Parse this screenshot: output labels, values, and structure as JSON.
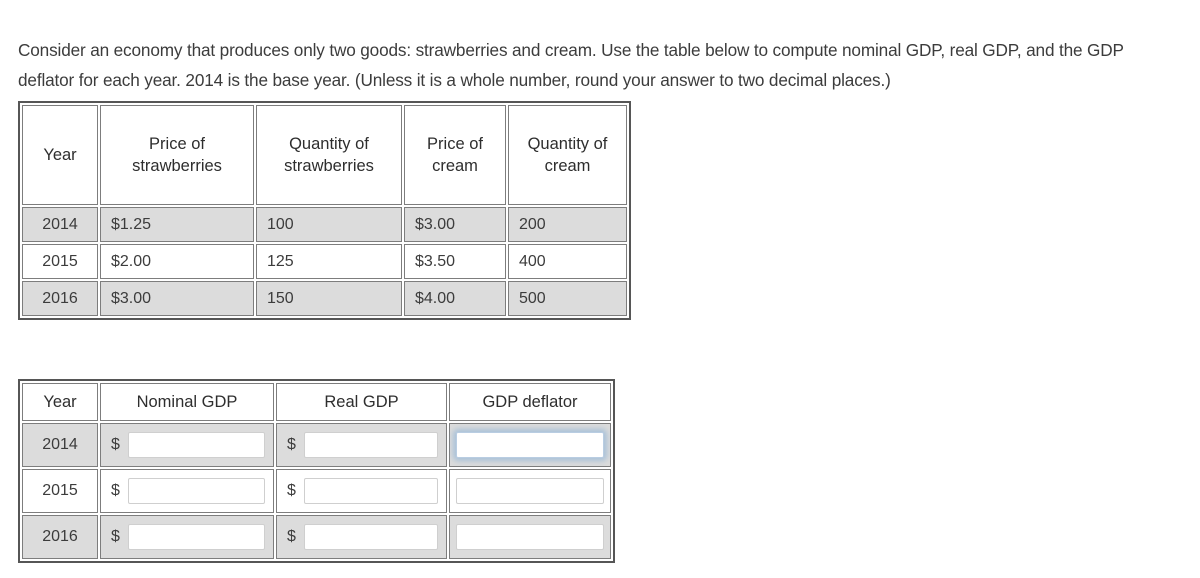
{
  "prompt": {
    "text": "Consider an economy that produces only two goods: strawberries and cream. Use the table below to compute nominal GDP, real GDP, and the GDP deflator for each year. 2014 is the base year. (Unless it is a whole number, round your answer to two decimal places.)"
  },
  "goods_table": {
    "headers": [
      "Year",
      "Price of strawberries",
      "Quantity of strawberries",
      "Price of cream",
      "Quantity of cream"
    ],
    "rows": [
      {
        "year": "2014",
        "price_strawberries": "$1.25",
        "qty_strawberries": "100",
        "price_cream": "$3.00",
        "qty_cream": "200",
        "shaded": true
      },
      {
        "year": "2015",
        "price_strawberries": "$2.00",
        "qty_strawberries": "125",
        "price_cream": "$3.50",
        "qty_cream": "400",
        "shaded": false
      },
      {
        "year": "2016",
        "price_strawberries": "$3.00",
        "qty_strawberries": "150",
        "price_cream": "$4.00",
        "qty_cream": "500",
        "shaded": true
      }
    ]
  },
  "answers_table": {
    "headers": [
      "Year",
      "Nominal GDP",
      "Real GDP",
      "GDP deflator"
    ],
    "currency_prefix": "$",
    "rows": [
      {
        "year": "2014",
        "nominal_gdp": "",
        "real_gdp": "",
        "gdp_deflator": "",
        "shaded": true,
        "focused_field": "gdp_deflator"
      },
      {
        "year": "2015",
        "nominal_gdp": "",
        "real_gdp": "",
        "gdp_deflator": "",
        "shaded": false,
        "focused_field": ""
      },
      {
        "year": "2016",
        "nominal_gdp": "",
        "real_gdp": "",
        "gdp_deflator": "",
        "shaded": true,
        "focused_field": ""
      }
    ]
  },
  "colors": {
    "text": "#3c3c3c",
    "table_outer_border": "#565656",
    "cell_border": "#7d7d7d",
    "shaded_row": "#dcdcdc",
    "focus_glow": "#8cb2d6"
  }
}
